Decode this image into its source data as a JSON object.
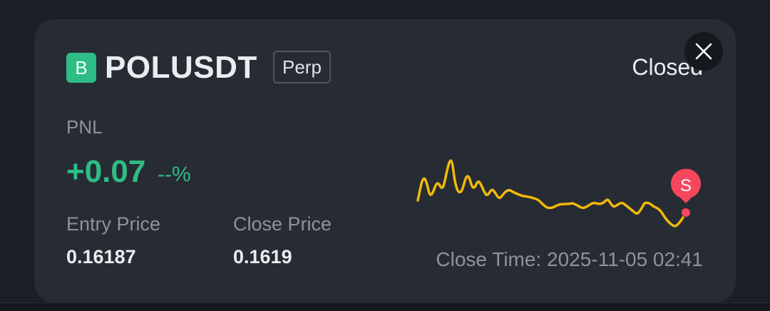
{
  "position": {
    "badge_letter": "B",
    "symbol": "POLUSDT",
    "contract_type": "Perp",
    "status": "Closed",
    "pnl_label": "PNL",
    "pnl_value": "+0.07",
    "pnl_percent": "--%",
    "entry_price_label": "Entry Price",
    "entry_price": "0.16187",
    "close_price_label": "Close Price",
    "close_price": "0.1619",
    "close_time": "Close Time: 2025-11-05 02:41"
  },
  "marker": {
    "label": "S",
    "color": "#f6465d"
  },
  "colors": {
    "accent_green": "#2ebd85",
    "sparkline": "#f0b90b",
    "card_bg": "#272b33"
  },
  "icons": {
    "close": "close-icon",
    "badge": "b-badge-icon"
  }
}
